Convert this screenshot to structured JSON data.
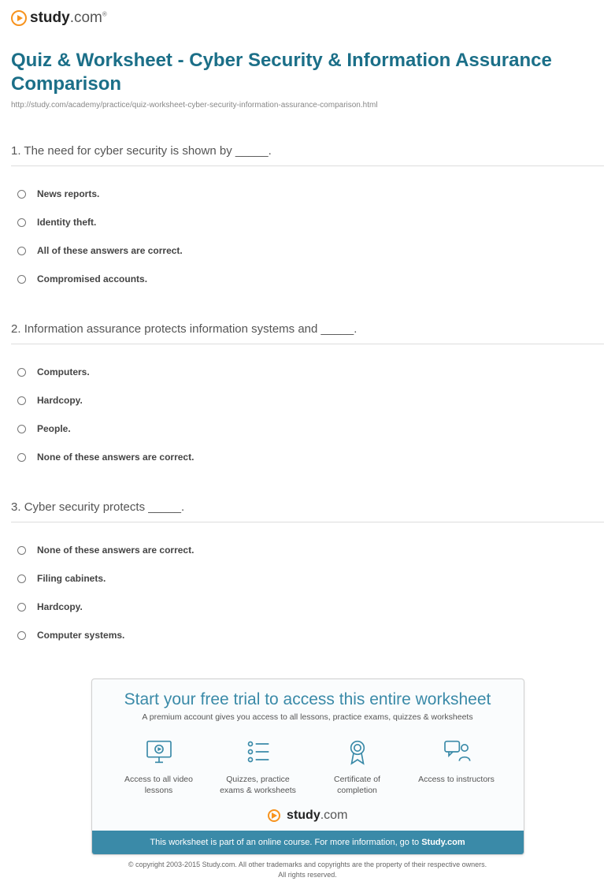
{
  "brand": {
    "name": "study",
    "suffix": ".com",
    "tm": "®"
  },
  "title": "Quiz & Worksheet - Cyber Security & Information Assurance Comparison",
  "url": "http://study.com/academy/practice/quiz-worksheet-cyber-security-information-assurance-comparison.html",
  "questions": [
    {
      "number": "1.",
      "text": "The need for cyber security is shown by _____.",
      "options": [
        "News reports.",
        "Identity theft.",
        "All of these answers are correct.",
        "Compromised accounts."
      ]
    },
    {
      "number": "2.",
      "text": "Information assurance protects information systems and _____.",
      "options": [
        "Computers.",
        "Hardcopy.",
        "People.",
        "None of these answers are correct."
      ]
    },
    {
      "number": "3.",
      "text": "Cyber security protects _____.",
      "options": [
        "None of these answers are correct.",
        "Filing cabinets.",
        "Hardcopy.",
        "Computer systems."
      ]
    }
  ],
  "promo": {
    "title": "Start your free trial to access this entire worksheet",
    "sub": "A premium account gives you access to all lessons, practice exams, quizzes & worksheets",
    "features": [
      {
        "label": "Access to all video lessons"
      },
      {
        "label": "Quizzes, practice exams & worksheets"
      },
      {
        "label": "Certificate of completion"
      },
      {
        "label": "Access to instructors"
      }
    ],
    "bar_prefix": "This worksheet is part of an online course. For more information, go to ",
    "bar_link": "Study.com"
  },
  "copyright": {
    "line1": "© copyright 2003-2015 Study.com. All other trademarks and copyrights are the property of their respective owners.",
    "line2": "All rights reserved."
  }
}
